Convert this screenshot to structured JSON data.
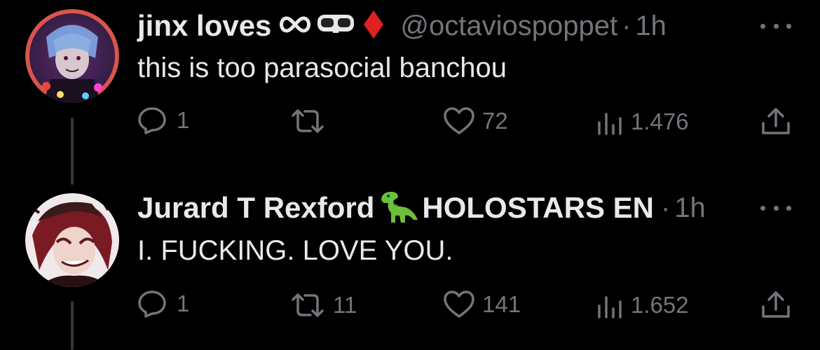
{
  "tweets": [
    {
      "name": "jinx loves",
      "handle": "@octaviospoppet",
      "separator": "·",
      "time": "1h",
      "text": "this is too parasocial banchou",
      "badges": [
        "infinity-icon",
        "goggles-icon",
        "red-diamond-icon"
      ],
      "actions": {
        "replies": "1",
        "retweets": "",
        "likes": "72",
        "views": "1.476"
      }
    },
    {
      "name": "Jurard T Rexford",
      "name_suffix": "HOLOSTARS EN",
      "separator": "·",
      "time": "1h",
      "text": "I. FUCKING. LOVE YOU.",
      "badges": [
        "t-rex-icon"
      ],
      "actions": {
        "replies": "1",
        "retweets": "11",
        "likes": "141",
        "views": "1.652"
      }
    }
  ],
  "colors": {
    "background": "#000000",
    "text": "#e7e9ea",
    "muted": "#71767b",
    "diamond": "#e0211f",
    "trex": "#6cbf3a"
  }
}
